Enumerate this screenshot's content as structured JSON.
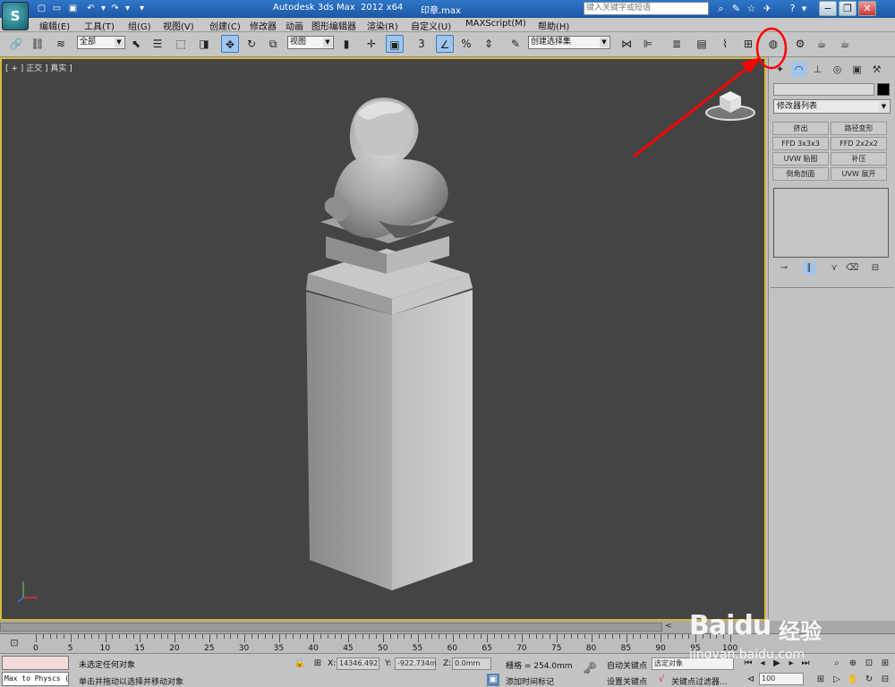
{
  "title_bar": {
    "app_title": "Autodesk 3ds Max  2012 x64",
    "file_name": "印章.max",
    "search_placeholder": "键入关键字或短语"
  },
  "menu": {
    "items": [
      "编辑(E)",
      "工具(T)",
      "组(G)",
      "视图(V)",
      "创建(C)",
      "修改器",
      "动画",
      "图形编辑器",
      "渲染(R)",
      "自定义(U)",
      "MAXScript(M)",
      "帮助(H)"
    ]
  },
  "toolbar": {
    "selection_filter": "全部",
    "reference_coord": "视图",
    "named_selection": "创建选择集",
    "snap_angle_label": "3",
    "percent_snap": "%"
  },
  "viewport": {
    "label": "[ + ] 正交 ] 真实 ]",
    "highlight_color": "#d6b93a"
  },
  "command_panel": {
    "modifier_list": "修改器列表",
    "modifier_buttons": [
      "挤出",
      "路径变形",
      "FFD 3x3x3",
      "FFD 2x2x2",
      "UVW 贴图",
      "补压",
      "倒角剖面",
      "UVW 展开"
    ]
  },
  "timeline": {
    "ticks": [
      "0",
      "5",
      "10",
      "15",
      "20",
      "25",
      "30",
      "35",
      "40",
      "45",
      "50",
      "55",
      "60",
      "65",
      "70",
      "75",
      "80",
      "85",
      "90",
      "95",
      "100"
    ],
    "range": "0 / 100"
  },
  "status_bar": {
    "maxscript": "Max to Physcs (",
    "status_line1": "未选定任何对象",
    "status_line2": "单击并拖动以选择并移动对象",
    "x_label": "X:",
    "x_value": "14346.492",
    "y_label": "Y:",
    "y_value": "-922.734m",
    "z_label": "Z:",
    "z_value": "0.0mm",
    "grid": "栅格 = 254.0mm",
    "add_time_tag": "添加时间标记",
    "auto_key": "自动关键点",
    "set_key": "设置关键点",
    "selected_object": "选定对象",
    "key_filter": "关键点过滤器...",
    "frame_value": "100"
  },
  "watermark": {
    "brand": "Baidu",
    "brand_cn": "经验",
    "url": "jingyan.baidu.com"
  },
  "annotation": {
    "arrow_color": "#ff0000"
  }
}
